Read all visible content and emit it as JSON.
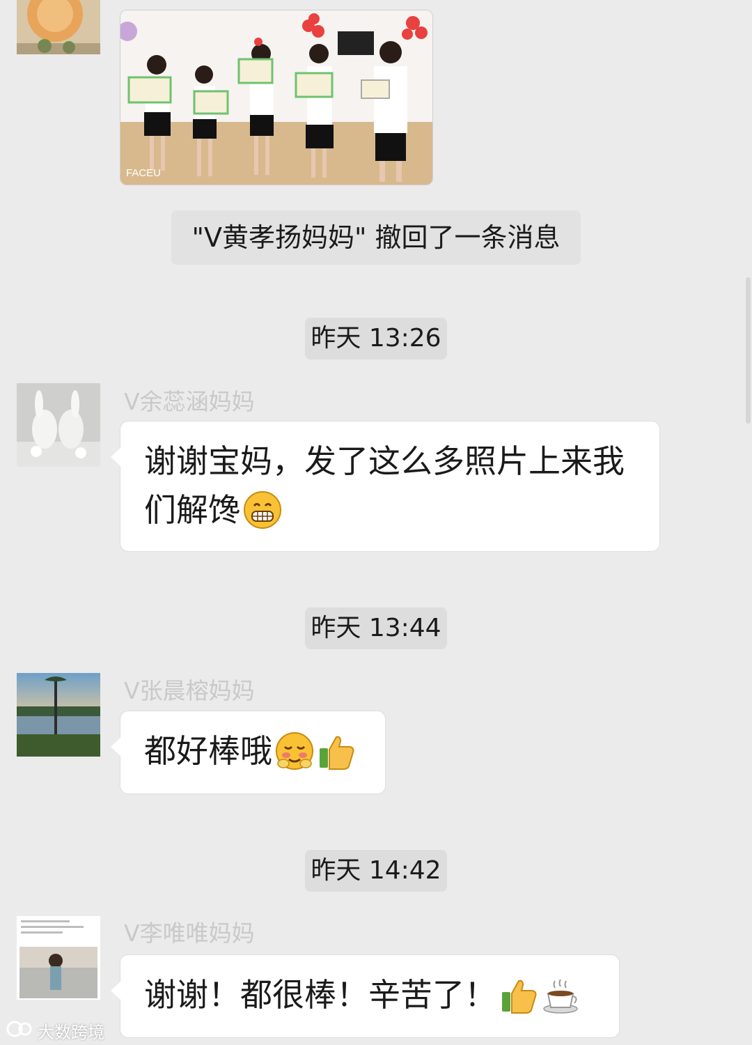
{
  "system_notice": "\"V黄孝扬妈妈\" 撤回了一条消息",
  "messages": [
    {
      "timestamp": "昨天 13:26",
      "sender": "V余蕊涵妈妈",
      "text_lines": [
        "谢谢宝妈，发了这么多照片上来我",
        "们解馋"
      ],
      "emojis": [
        "grin-emoji"
      ]
    },
    {
      "timestamp": "昨天 13:44",
      "sender": "V张晨榕妈妈",
      "text_lines": [
        "都好棒哦"
      ],
      "emojis": [
        "shy-emoji",
        "thumbs-up-emoji"
      ]
    },
    {
      "timestamp": "昨天 14:42",
      "sender": "V李唯唯妈妈",
      "text_lines": [
        "谢谢！都很棒！辛苦了！"
      ],
      "emojis": [
        "thumbs-up-emoji",
        "coffee-emoji"
      ]
    }
  ],
  "photo_caption": "FACEU",
  "watermark": "大数跨境",
  "colors": {
    "background": "#ebebeb",
    "bubble": "#ffffff",
    "pill": "#dadada",
    "sender_name": "#c9c9c9"
  }
}
